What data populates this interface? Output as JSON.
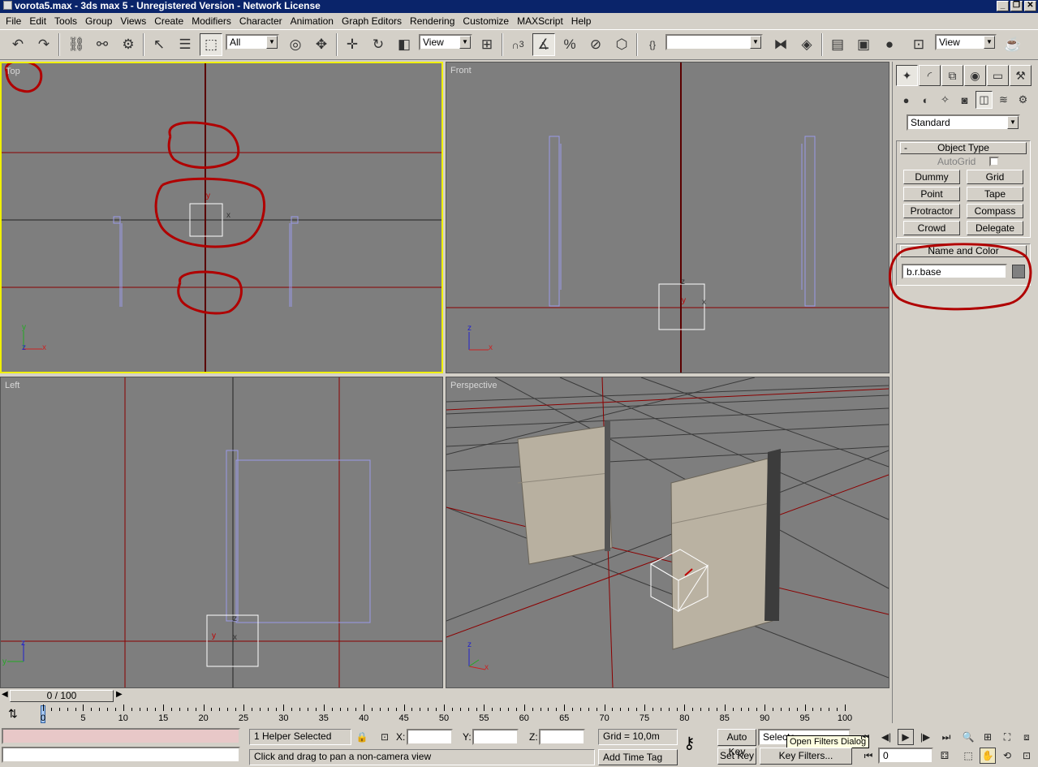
{
  "window": {
    "title": "vorota5.max - 3ds max 5 - Unregistered Version - Network License",
    "min": "_",
    "max": "❐",
    "close": "✕"
  },
  "menu": [
    "File",
    "Edit",
    "Tools",
    "Group",
    "Views",
    "Create",
    "Modifiers",
    "Character",
    "Animation",
    "Graph Editors",
    "Rendering",
    "Customize",
    "MAXScript",
    "Help"
  ],
  "toolbar": {
    "selection_filter": "All",
    "ref_coord": "View",
    "named_selection": "",
    "render_view": "View",
    "snap_label": "3"
  },
  "viewports": {
    "top": "Top",
    "front": "Front",
    "left": "Left",
    "perspective": "Perspective"
  },
  "axis": {
    "x": "x",
    "y": "y",
    "z": "z"
  },
  "command_panel": {
    "category_dropdown": "Standard",
    "object_type": {
      "title": "Object Type",
      "minus": "-",
      "autogrid": "AutoGrid",
      "buttons": [
        "Dummy",
        "Grid",
        "Point",
        "Tape",
        "Protractor",
        "Compass",
        "Crowd",
        "Delegate"
      ]
    },
    "name_color": {
      "title": "Name and Color",
      "name_value": "b.r.base",
      "color": "#808080"
    }
  },
  "time": {
    "slider": "0 / 100",
    "ticks": [
      "0",
      "5",
      "10",
      "15",
      "20",
      "25",
      "30",
      "35",
      "40",
      "45",
      "50",
      "55",
      "60",
      "65",
      "70",
      "75",
      "80",
      "85",
      "90",
      "95",
      "100"
    ]
  },
  "status": {
    "selected": "1 Helper Selected",
    "x_label": "X:",
    "y_label": "Y:",
    "z_label": "Z:",
    "x_value": "",
    "y_value": "",
    "z_value": "",
    "grid": "Grid = 10,0m",
    "prompt": "Click and drag to pan a non-camera view",
    "add_time_tag": "Add Time Tag",
    "auto_key": "Auto Key",
    "set_key": "Set Key",
    "selected_dropdown": "Selecte",
    "tooltip": "Open Filters Dialog",
    "key_filters": "Key Filters...",
    "frame": "0"
  },
  "colors": {
    "viewport_bg": "#7e7e7e",
    "grid_main": "#8b0000",
    "annotation": "#b00000",
    "active_border": "#f0f000",
    "helper_lines": "#9a9ae8"
  }
}
